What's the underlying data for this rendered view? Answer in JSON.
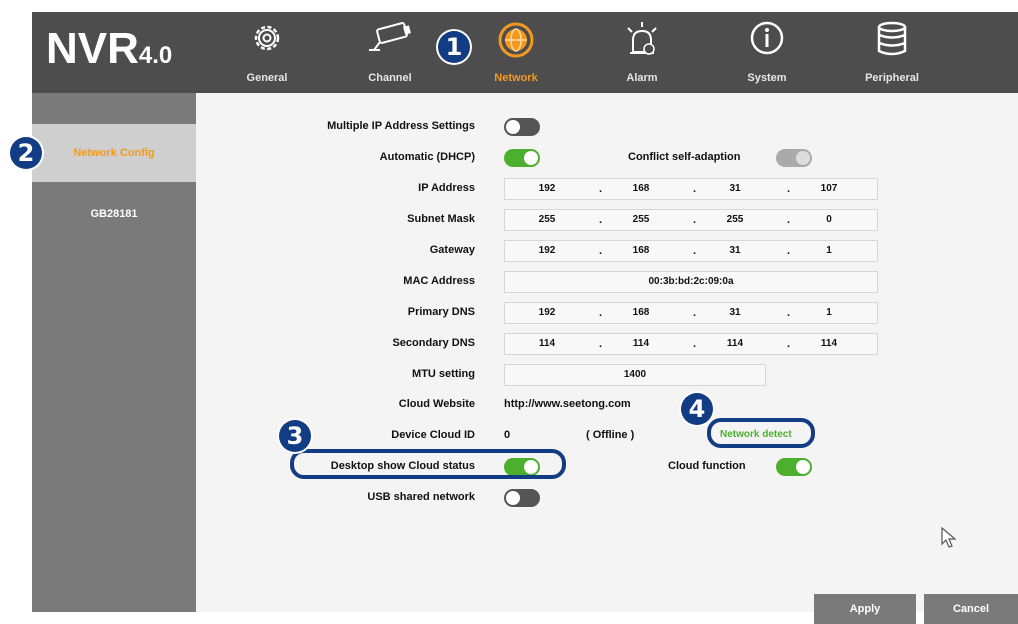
{
  "app": {
    "logo_main": "NVR",
    "logo_version": "4.0"
  },
  "nav": {
    "items": [
      {
        "label": "General",
        "icon": "gear-icon"
      },
      {
        "label": "Channel",
        "icon": "camera-icon"
      },
      {
        "label": "Network",
        "icon": "globe-icon",
        "active": true
      },
      {
        "label": "Alarm",
        "icon": "alarm-icon"
      },
      {
        "label": "System",
        "icon": "info-icon"
      },
      {
        "label": "Peripheral",
        "icon": "database-icon"
      }
    ]
  },
  "sidebar": {
    "items": [
      {
        "label": "Network Config",
        "active": true
      },
      {
        "label": "GB28181"
      }
    ]
  },
  "form": {
    "multiple_ip_label": "Multiple IP Address Settings",
    "dhcp_label": "Automatic (DHCP)",
    "conflict_label": "Conflict self-adaption",
    "ip_label": "IP Address",
    "ip": [
      "192",
      "168",
      "31",
      "107"
    ],
    "subnet_label": "Subnet Mask",
    "subnet": [
      "255",
      "255",
      "255",
      "0"
    ],
    "gateway_label": "Gateway",
    "gateway": [
      "192",
      "168",
      "31",
      "1"
    ],
    "mac_label": "MAC Address",
    "mac": "00:3b:bd:2c:09:0a",
    "dns1_label": "Primary DNS",
    "dns1": [
      "192",
      "168",
      "31",
      "1"
    ],
    "dns2_label": "Secondary DNS",
    "dns2": [
      "114",
      "114",
      "114",
      "114"
    ],
    "mtu_label": "MTU setting",
    "mtu": "1400",
    "cloud_website_label": "Cloud Website",
    "cloud_website": "http://www.seetong.com",
    "cloud_id_label": "Device Cloud ID",
    "cloud_id": "0",
    "cloud_status": "( Offline )",
    "network_detect": "Network detect",
    "desktop_cloud_label": "Desktop show Cloud status",
    "cloud_function_label": "Cloud function",
    "usb_label": "USB shared network"
  },
  "toggles": {
    "multiple_ip": "off",
    "dhcp": "on",
    "conflict": "disabled",
    "desktop_cloud": "on",
    "cloud_function": "on",
    "usb": "off"
  },
  "buttons": {
    "apply": "Apply",
    "cancel": "Cancel"
  },
  "callouts": [
    "1",
    "2",
    "3",
    "4"
  ],
  "colors": {
    "accent": "#f39a1e",
    "toggle_on": "#4caf2e",
    "callout": "#123c84",
    "topbar": "#4d4d4d",
    "sidebar": "#7a7a7a"
  }
}
